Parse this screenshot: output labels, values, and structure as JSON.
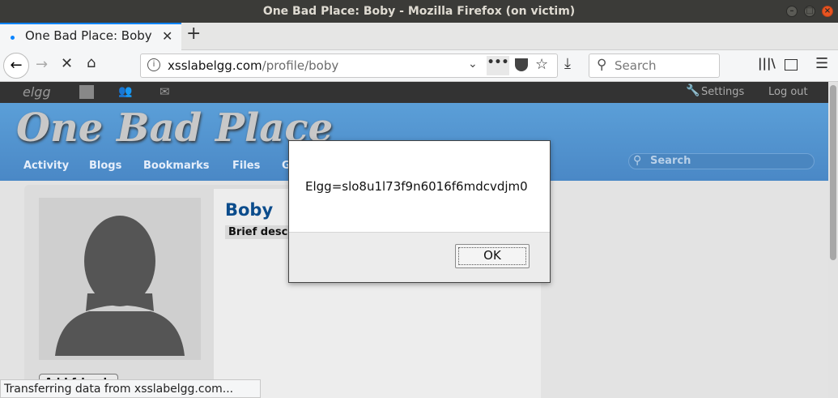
{
  "window": {
    "title": "One Bad Place: Boby - Mozilla Firefox (on victim)"
  },
  "tab": {
    "label": "One Bad Place: Boby",
    "close": "✕",
    "new_tab": "+"
  },
  "nav": {
    "url_host": "xsslabelgg.com",
    "url_path": "/profile/boby",
    "search_placeholder": "Search"
  },
  "elgg_topbar": {
    "logo": "elgg",
    "settings": "Settings",
    "logout": "Log out"
  },
  "site": {
    "name": "One Bad Place",
    "menu": [
      "Activity",
      "Blogs",
      "Bookmarks",
      "Files",
      "G"
    ],
    "search_placeholder": "Search"
  },
  "profile": {
    "name": "Boby",
    "brief_label": "Brief desc",
    "add_friend": "Add friend"
  },
  "dialog": {
    "message": "Elgg=slo8u1l73f9n6016f6mdcvdjm0",
    "ok": "OK"
  },
  "status": {
    "text": "Transferring data from xsslabelgg.com..."
  },
  "colors": {
    "accent": "#0a84ff",
    "header": "#4a88c6",
    "titlebar": "#3b3b38"
  }
}
